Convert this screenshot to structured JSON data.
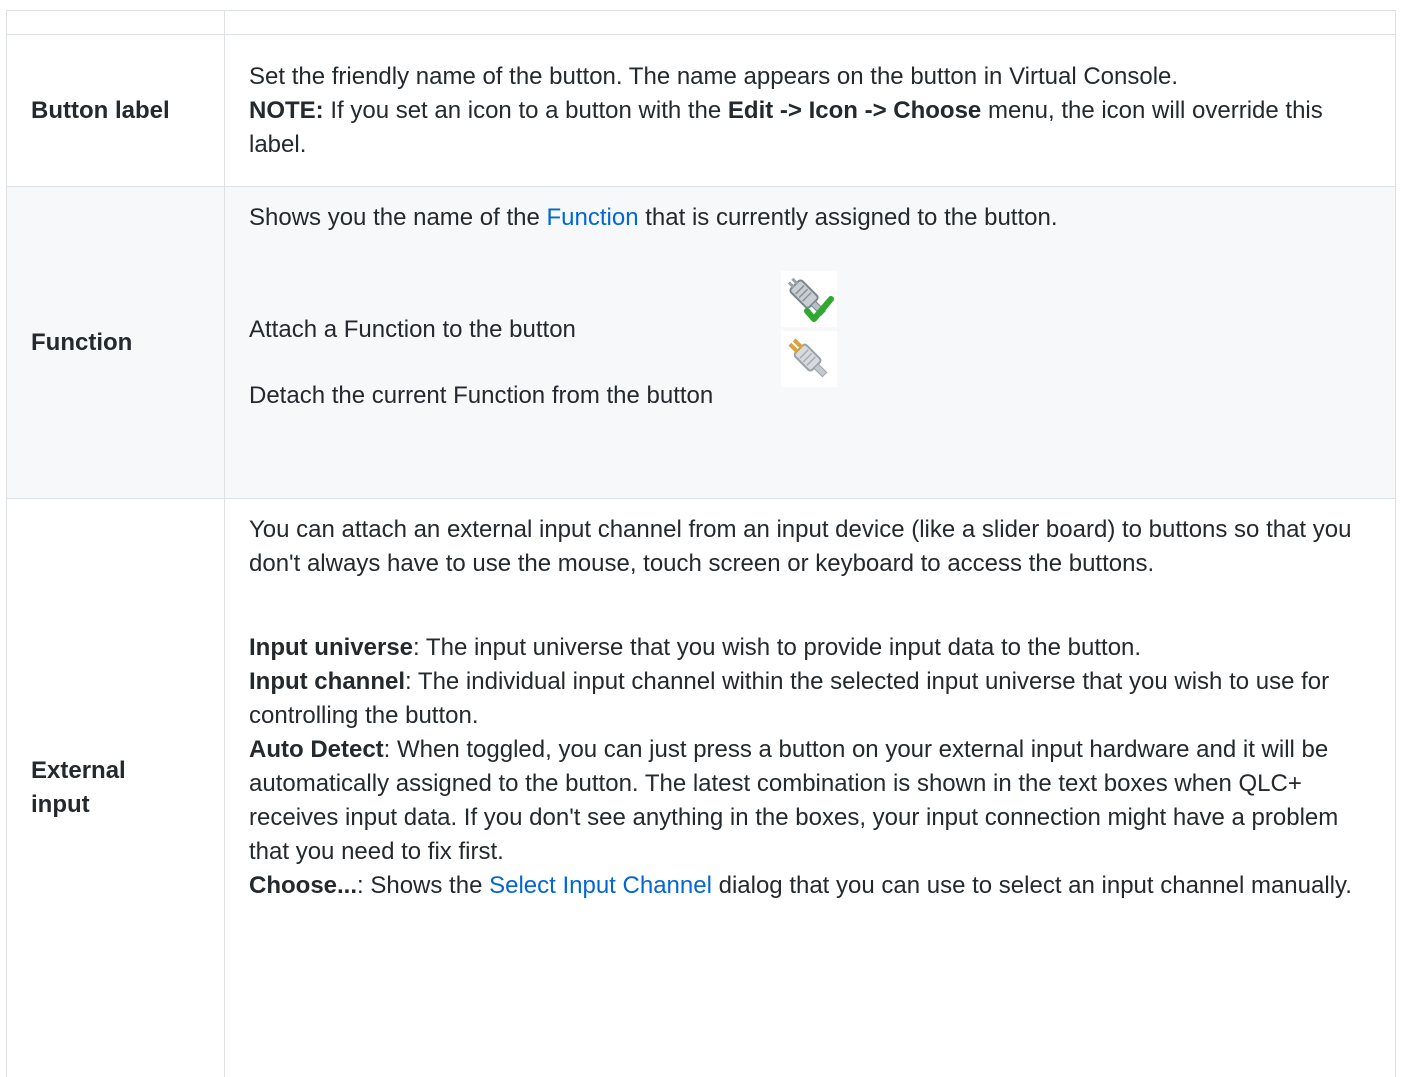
{
  "rows": {
    "button_label": {
      "label": "Button label",
      "line1": "Set the friendly name of the button. The name appears on the button in Virtual Console.",
      "note_strong": "NOTE:",
      "note_text1": " If you set an icon to a button with the ",
      "note_menu": "Edit -> Icon -> Choose",
      "note_text2": " menu, the icon will override this label."
    },
    "function": {
      "label": "Function",
      "line_pre": "Shows you the name of the ",
      "line_link": "Function",
      "line_post": " that is currently assigned to the button.",
      "attach_text": "Attach a Function to the button",
      "attach_icon": "plug-attach-icon",
      "detach_text": "Detach the current Function from the button",
      "detach_icon": "plug-detach-icon"
    },
    "external_input": {
      "label": "External input",
      "intro": "You can attach an external input channel from an input device (like a slider board) to buttons so that you don't always have to use the mouse, touch screen or keyboard to access the buttons.",
      "universe_term": "Input universe",
      "universe_text": ": The input universe that you wish to provide input data to the button.",
      "channel_term": "Input channel",
      "channel_text": ": The individual input channel within the selected input universe that you wish to use for controlling the button.",
      "autodetect_term": "Auto Detect",
      "autodetect_text": ": When toggled, you can just press a button on your external input hardware and it will be automatically assigned to the button. The latest combination is shown in the text boxes when QLC+ receives input data. If you don't see anything in the boxes, your input connection might have a problem that you need to fix first.",
      "choose_term": "Choose...",
      "choose_text_pre": ": Shows the ",
      "choose_link": "Select Input Channel",
      "choose_text_post": " dialog that you can use to select an input channel manually."
    }
  },
  "colors": {
    "link": "#0366d6",
    "border": "#dfe2e5",
    "alt_row": "#f6f8fa",
    "text": "#24292e",
    "check_green": "#2ea82e",
    "plug_gold": "#d9a23a"
  }
}
